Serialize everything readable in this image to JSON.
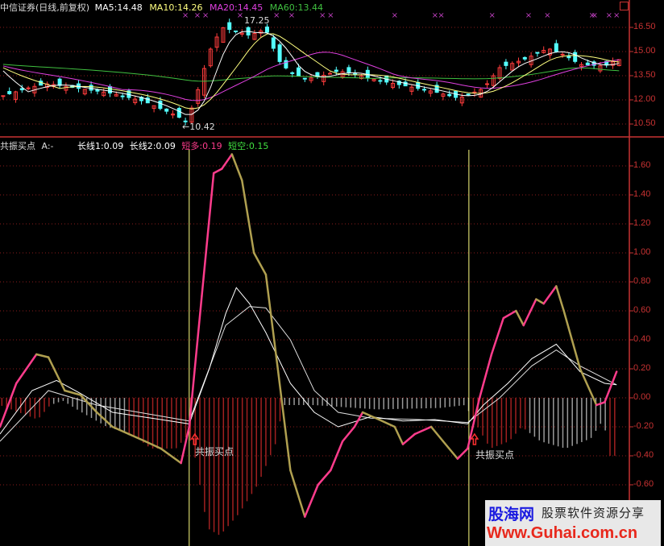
{
  "header_top": {
    "title": "中信证券(日线,前复权)",
    "ma5": "MA5:14.48",
    "ma10": "MA10:14.26",
    "ma20": "MA20:14.45",
    "ma60": "MA60:13.44"
  },
  "header_bottom": {
    "name": "共振买点",
    "a": "A:-",
    "long1": "长线1:0.09",
    "long2": "长线2:0.09",
    "short_long_label": "短多",
    "short_long_value": ":0.19",
    "short_short_label": "短空",
    "short_short_value": ":0.15"
  },
  "annotations": {
    "high": "17.25",
    "low": "←10.42",
    "buy1": "共振买点",
    "buy2": "共振买点"
  },
  "watermark": {
    "cn": "股海网",
    "slogan": "股票软件资源分享",
    "url": "Www.Guhai.com.cn"
  },
  "colors": {
    "up": "#ff3c3c",
    "down": "#54ffff",
    "ma5": "#ffffff",
    "ma10": "#ffff80",
    "ma20": "#e040e0",
    "ma60": "#40c040",
    "axis": "#c83232",
    "signal": "#ffff80"
  },
  "chart_data": [
    {
      "type": "candlestick",
      "title": "中信证券(日线,前复权)",
      "x_domain": [
        0,
        100
      ],
      "ylim": [
        10.0,
        17.25
      ],
      "yticks": [
        "16.50",
        "15.00",
        "13.50",
        "12.00",
        "10.50"
      ],
      "ytick_values": [
        16.5,
        15.0,
        13.5,
        12.0,
        10.5
      ],
      "close_keypoints": [
        [
          0,
          12.2
        ],
        [
          5,
          12.8
        ],
        [
          7.7,
          13.0
        ],
        [
          12.8,
          12.7
        ],
        [
          17.9,
          12.4
        ],
        [
          23,
          11.9
        ],
        [
          28.2,
          11.0
        ],
        [
          29.7,
          10.6
        ],
        [
          31.4,
          12.5
        ],
        [
          33.3,
          15.0
        ],
        [
          35.3,
          16.5
        ],
        [
          37.2,
          16.3
        ],
        [
          39.7,
          16.0
        ],
        [
          42.3,
          16.4
        ],
        [
          44.2,
          14.5
        ],
        [
          46.2,
          13.7
        ],
        [
          48.7,
          13.3
        ],
        [
          51.3,
          13.5
        ],
        [
          53.8,
          13.8
        ],
        [
          56.4,
          13.6
        ],
        [
          60.3,
          13.2
        ],
        [
          64.1,
          12.9
        ],
        [
          69.2,
          12.5
        ],
        [
          73,
          12.1
        ],
        [
          76.9,
          12.7
        ],
        [
          79.5,
          14.0
        ],
        [
          83.3,
          14.5
        ],
        [
          87.2,
          15.2
        ],
        [
          89.7,
          14.8
        ],
        [
          92.3,
          14.2
        ],
        [
          96.2,
          14.1
        ],
        [
          98.1,
          14.5
        ]
      ],
      "high": 17.25,
      "low": 10.42,
      "signal_marks_x": [
        29.5,
        31.4,
        32.7,
        38.2,
        44,
        46.4,
        51.3,
        52.6,
        62.8,
        69.2,
        70.2,
        78.3,
        84.1,
        87.1,
        94.2,
        94.6,
        96.9,
        98.1
      ]
    },
    {
      "type": "line",
      "title": "共振买点",
      "x_domain": [
        0,
        100
      ],
      "ylim": [
        -0.7,
        1.75
      ],
      "yticks": [
        "1.60",
        "1.40",
        "1.20",
        "1.00",
        "0.80",
        "0.60",
        "0.40",
        "0.20",
        "0.00",
        "-0.20",
        "-0.40",
        "-0.60"
      ],
      "ytick_values": [
        1.6,
        1.4,
        1.2,
        1.0,
        0.8,
        0.6,
        0.4,
        0.2,
        0.0,
        -0.2,
        -0.4,
        -0.6
      ],
      "series": [
        {
          "name": "短多/短空",
          "points": [
            [
              0,
              -0.2
            ],
            [
              2.6,
              0.1
            ],
            [
              5.8,
              0.3
            ],
            [
              7.7,
              0.28
            ],
            [
              10.3,
              0.05
            ],
            [
              12.8,
              0.02
            ],
            [
              15.4,
              -0.1
            ],
            [
              17.9,
              -0.2
            ],
            [
              20.5,
              -0.25
            ],
            [
              23.1,
              -0.3
            ],
            [
              25.6,
              -0.35
            ],
            [
              28.8,
              -0.45
            ],
            [
              30.1,
              -0.2
            ],
            [
              32.1,
              0.7
            ],
            [
              34,
              1.55
            ],
            [
              35.3,
              1.58
            ],
            [
              36.9,
              1.68
            ],
            [
              38.5,
              1.5
            ],
            [
              40.4,
              1.0
            ],
            [
              42.3,
              0.85
            ],
            [
              44.2,
              0.2
            ],
            [
              46.2,
              -0.5
            ],
            [
              48.5,
              -0.82
            ],
            [
              50.6,
              -0.6
            ],
            [
              52.6,
              -0.5
            ],
            [
              54.5,
              -0.3
            ],
            [
              56.4,
              -0.2
            ],
            [
              57.7,
              -0.1
            ],
            [
              60.3,
              -0.15
            ],
            [
              62.8,
              -0.2
            ],
            [
              64.1,
              -0.32
            ],
            [
              66,
              -0.25
            ],
            [
              68.6,
              -0.2
            ],
            [
              70.5,
              -0.3
            ],
            [
              72.8,
              -0.42
            ],
            [
              74.4,
              -0.35
            ],
            [
              76.3,
              0.0
            ],
            [
              78.2,
              0.3
            ],
            [
              80.1,
              0.55
            ],
            [
              82.1,
              0.6
            ],
            [
              83.3,
              0.5
            ],
            [
              85.3,
              0.68
            ],
            [
              86.5,
              0.65
            ],
            [
              88.5,
              0.77
            ],
            [
              89.7,
              0.6
            ],
            [
              92.3,
              0.2
            ],
            [
              94.9,
              -0.05
            ],
            [
              96.2,
              -0.03
            ],
            [
              98.1,
              0.18
            ]
          ]
        },
        {
          "name": "长线1",
          "points": [
            [
              0,
              -0.25
            ],
            [
              5.1,
              0.05
            ],
            [
              9,
              0.12
            ],
            [
              12.8,
              0.03
            ],
            [
              17.9,
              -0.1
            ],
            [
              25.6,
              -0.15
            ],
            [
              30.1,
              -0.18
            ],
            [
              33.3,
              0.2
            ],
            [
              35.9,
              0.58
            ],
            [
              37.6,
              0.76
            ],
            [
              39.7,
              0.65
            ],
            [
              42.3,
              0.45
            ],
            [
              46.2,
              0.1
            ],
            [
              50,
              -0.1
            ],
            [
              53.8,
              -0.2
            ],
            [
              59,
              -0.13
            ],
            [
              64.1,
              -0.16
            ],
            [
              69.2,
              -0.15
            ],
            [
              74.4,
              -0.18
            ],
            [
              76.9,
              -0.05
            ],
            [
              80.8,
              0.1
            ],
            [
              84.6,
              0.27
            ],
            [
              88.5,
              0.37
            ],
            [
              92.3,
              0.18
            ],
            [
              96.2,
              0.1
            ],
            [
              98.1,
              0.09
            ]
          ]
        },
        {
          "name": "长线2",
          "points": [
            [
              0,
              -0.3
            ],
            [
              7.7,
              0.05
            ],
            [
              15.4,
              -0.05
            ],
            [
              30.1,
              -0.16
            ],
            [
              35.9,
              0.5
            ],
            [
              39.7,
              0.63
            ],
            [
              42.3,
              0.62
            ],
            [
              46.2,
              0.4
            ],
            [
              50,
              0.05
            ],
            [
              53.8,
              -0.1
            ],
            [
              59,
              -0.14
            ],
            [
              66.7,
              -0.15
            ],
            [
              74.4,
              -0.17
            ],
            [
              79.5,
              0.0
            ],
            [
              84.6,
              0.22
            ],
            [
              88.5,
              0.33
            ],
            [
              92.3,
              0.22
            ],
            [
              98.1,
              0.09
            ]
          ]
        }
      ],
      "histogram_keypoints": [
        [
          0,
          -0.05
        ],
        [
          3,
          -0.1
        ],
        [
          6,
          -0.15
        ],
        [
          8,
          -0.05
        ],
        [
          10,
          -0.02
        ],
        [
          13,
          -0.1
        ],
        [
          17,
          -0.2
        ],
        [
          21,
          -0.25
        ],
        [
          24,
          -0.35
        ],
        [
          28,
          -0.35
        ],
        [
          30,
          -0.25
        ],
        [
          31,
          -0.4
        ],
        [
          33,
          -0.9
        ],
        [
          35,
          -0.95
        ],
        [
          38,
          -0.8
        ],
        [
          41,
          -0.6
        ],
        [
          44,
          -0.3
        ],
        [
          45,
          -0.05
        ],
        [
          50,
          -0.05
        ],
        [
          60,
          -0.08
        ],
        [
          70,
          -0.07
        ],
        [
          74,
          -0.05
        ],
        [
          76,
          -0.2
        ],
        [
          78,
          -0.35
        ],
        [
          81,
          -0.3
        ],
        [
          83,
          -0.2
        ],
        [
          86,
          -0.3
        ],
        [
          90,
          -0.35
        ],
        [
          94,
          -0.28
        ],
        [
          96,
          -0.15
        ],
        [
          97,
          -0.4
        ],
        [
          98,
          -0.4
        ]
      ],
      "histogram_red_ranges": [
        [
          0,
          8
        ],
        [
          20,
          45
        ],
        [
          75,
          84
        ],
        [
          96.5,
          100
        ]
      ],
      "buy_signals_x": [
        30.1,
        74.6
      ]
    }
  ]
}
